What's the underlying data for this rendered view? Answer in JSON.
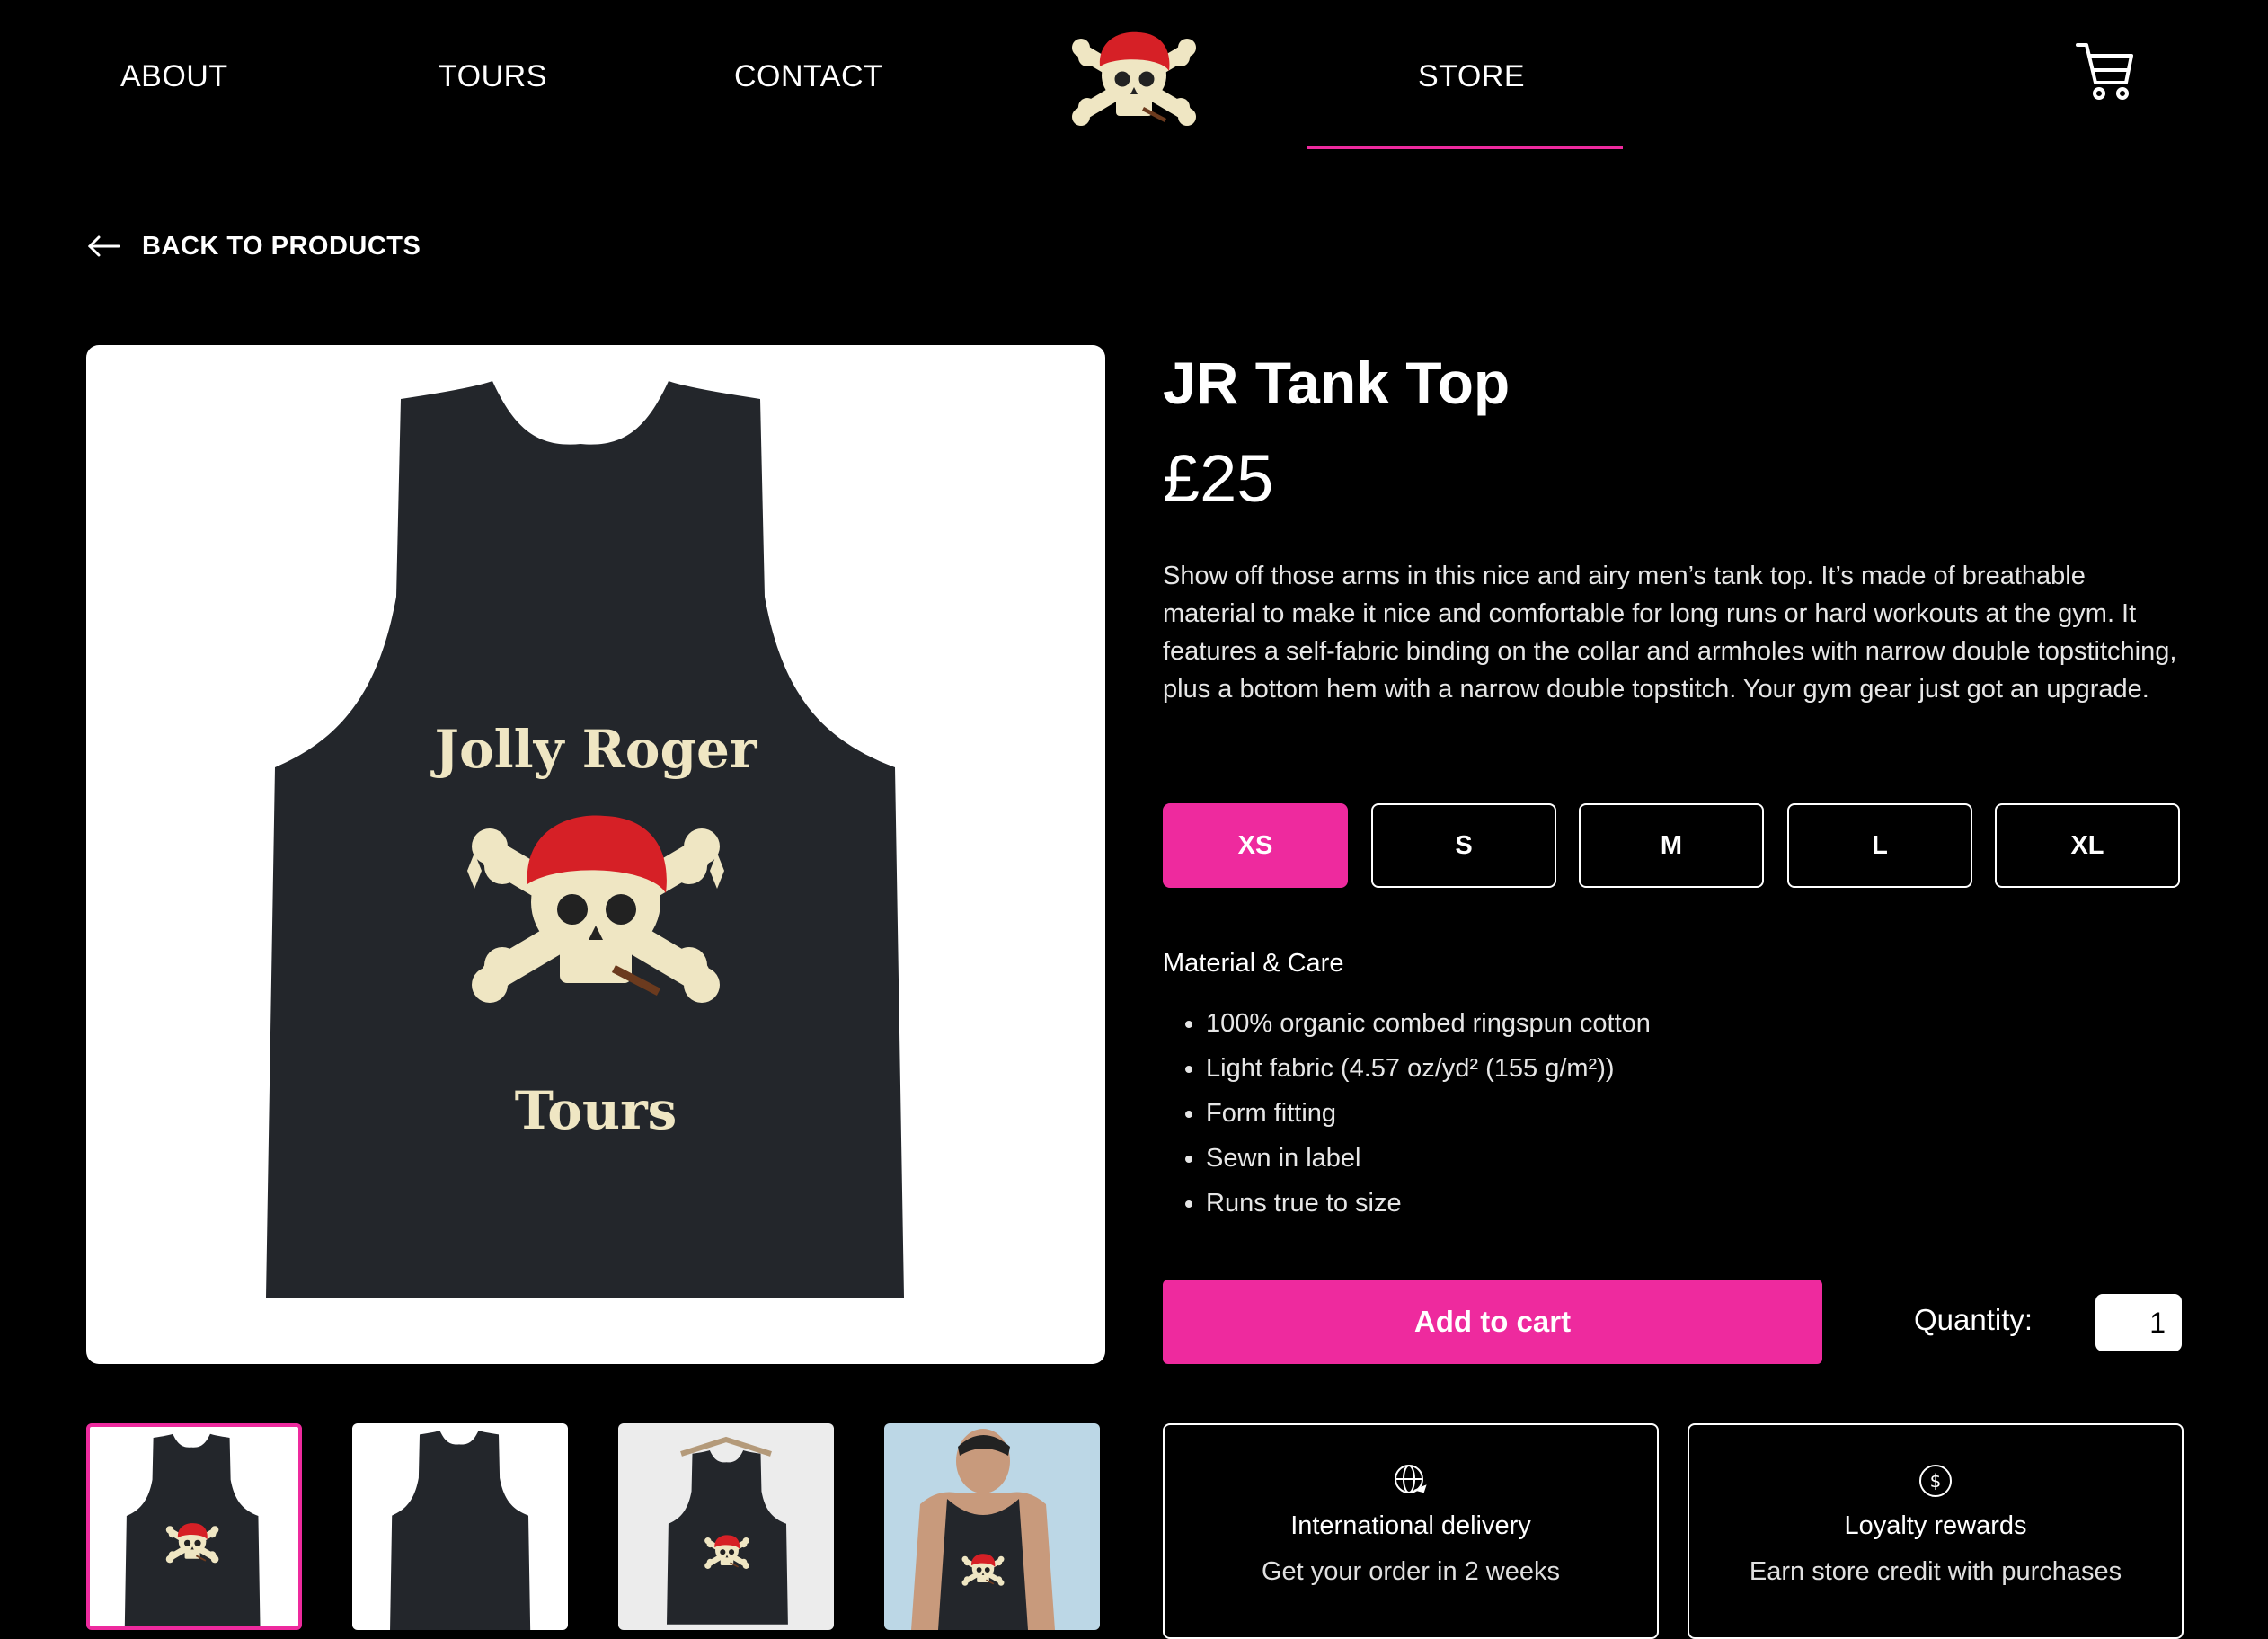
{
  "nav": {
    "items": [
      "ABOUT",
      "TOURS",
      "CONTACT",
      "STORE"
    ],
    "active": "STORE",
    "cart_icon": "cart-icon",
    "logo": {
      "icon": "pirate-skull-logo"
    }
  },
  "back": {
    "label": "BACK TO PRODUCTS",
    "icon": "arrow-left-icon"
  },
  "product": {
    "title": "JR Tank Top",
    "price": "£25",
    "description": "Show off those arms in this nice and airy men’s tank top. It’s made of breathable material to make it nice and comfortable for long runs or hard workouts at the gym. It features a self-fabric binding on the collar and armholes with narrow double topstitching, plus a bottom hem with a narrow double topstitch. Your gym gear just got an upgrade.",
    "sizes": [
      "XS",
      "S",
      "M",
      "L",
      "XL"
    ],
    "selected_size": "XS",
    "material_title": "Material & Care",
    "material": [
      "100% organic combed ringspun cotton",
      "Light fabric (4.57 oz/yd² (155 g/m²))",
      "Form fitting",
      "Sewn in label",
      "Runs true to size"
    ],
    "add_to_cart": "Add to cart",
    "quantity_label": "Quantity:",
    "quantity": "1",
    "print_text": {
      "top": "Jolly Roger",
      "bottom": "Tours"
    }
  },
  "gallery": {
    "thumbnails": [
      "front-view",
      "back-view",
      "hanger-view",
      "model-view"
    ],
    "selected": 0
  },
  "info_cards": [
    {
      "icon": "globe-plane-icon",
      "title": "International delivery",
      "subtitle": "Get your order in 2 weeks"
    },
    {
      "icon": "dollar-coin-icon",
      "title": "Loyalty rewards",
      "subtitle": "Earn store credit with purchases"
    }
  ],
  "colors": {
    "accent": "#ee2a9e",
    "background": "#000000",
    "shirt": "#23262b"
  }
}
